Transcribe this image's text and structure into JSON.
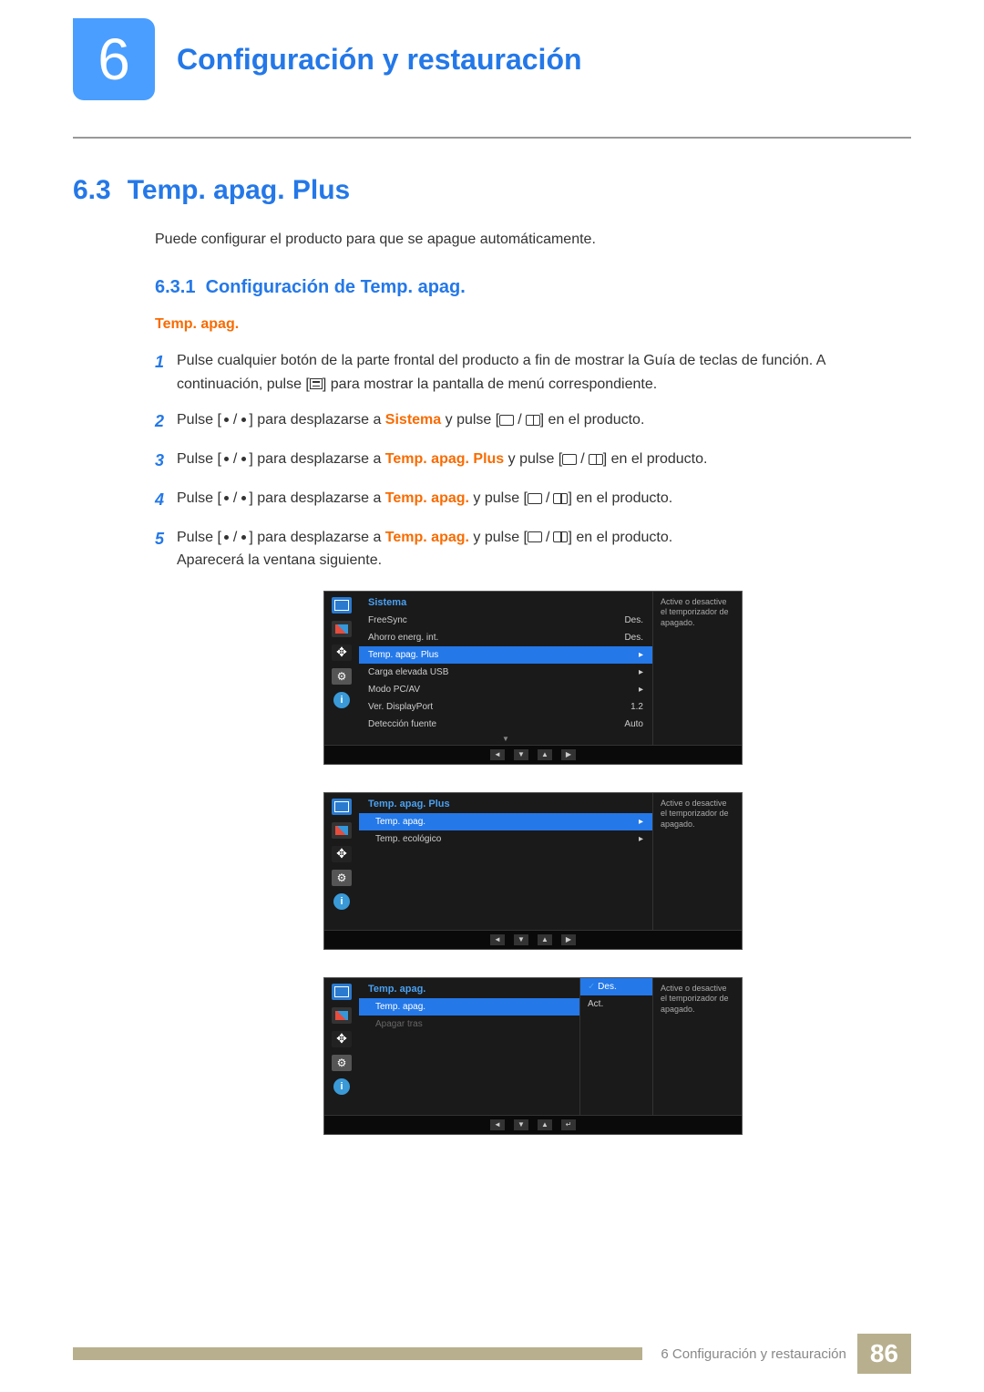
{
  "chapter": {
    "number": "6",
    "title": "Configuración y restauración"
  },
  "section": {
    "number": "6.3",
    "title": "Temp. apag. Plus"
  },
  "intro": "Puede configurar el producto para que se apague automáticamente.",
  "subsection": {
    "number": "6.3.1",
    "title": "Configuración de Temp. apag."
  },
  "subSubTitle": "Temp. apag.",
  "steps": [
    {
      "n": "1",
      "pre": "Pulse cualquier botón de la parte frontal del producto a fin de mostrar la Guía de teclas de función. A continuación, pulse [",
      "post": "] para mostrar la pantalla de menú correspondiente."
    },
    {
      "n": "2",
      "pre": "Pulse [",
      "mid": "] para desplazarse a ",
      "hl": "Sistema",
      "mid2": " y pulse [",
      "post": "] en el producto."
    },
    {
      "n": "3",
      "pre": "Pulse [",
      "mid": "] para desplazarse a ",
      "hl": "Temp. apag. Plus",
      "mid2": " y pulse [",
      "post": "] en el producto."
    },
    {
      "n": "4",
      "pre": "Pulse [",
      "mid": "] para desplazarse a ",
      "hl": "Temp. apag.",
      "mid2": " y pulse [",
      "post": "] en el producto."
    },
    {
      "n": "5",
      "pre": "Pulse [",
      "mid": "] para desplazarse a ",
      "hl": "Temp. apag.",
      "mid2": " y pulse [",
      "post": "] en el producto.",
      "extra": "Aparecerá la ventana siguiente."
    }
  ],
  "osd": {
    "help": "Active o desactive el temporizador de apagado.",
    "menu1": {
      "title": "Sistema",
      "items": [
        {
          "label": "FreeSync",
          "value": "Des."
        },
        {
          "label": "Ahorro energ. int.",
          "value": "Des."
        },
        {
          "label": "Temp. apag. Plus",
          "value": "",
          "sel": true,
          "arrow": true
        },
        {
          "label": "Carga elevada USB",
          "value": "",
          "arrow": true
        },
        {
          "label": "Modo PC/AV",
          "value": "",
          "arrow": true
        },
        {
          "label": "Ver. DisplayPort",
          "value": "1.2"
        },
        {
          "label": "Detección fuente",
          "value": "Auto"
        }
      ]
    },
    "menu2": {
      "title": "Temp. apag. Plus",
      "items": [
        {
          "label": "Temp. apag.",
          "sel": true,
          "sub": true,
          "arrow": true
        },
        {
          "label": "Temp. ecológico",
          "sub": true,
          "arrow": true
        }
      ]
    },
    "menu3": {
      "title": "Temp. apag.",
      "items": [
        {
          "label": "Temp. apag.",
          "sel": true,
          "sub": true
        },
        {
          "label": "Apagar tras",
          "sub": true,
          "dim": true
        }
      ],
      "options": [
        {
          "label": "Des.",
          "sel": true,
          "chk": true
        },
        {
          "label": "Act."
        }
      ]
    },
    "nav": [
      "◄",
      "▼",
      "▲",
      "▶"
    ],
    "nav3": [
      "◄",
      "▼",
      "▲",
      "↵"
    ]
  },
  "footer": {
    "text": "6 Configuración y restauración",
    "page": "86"
  }
}
